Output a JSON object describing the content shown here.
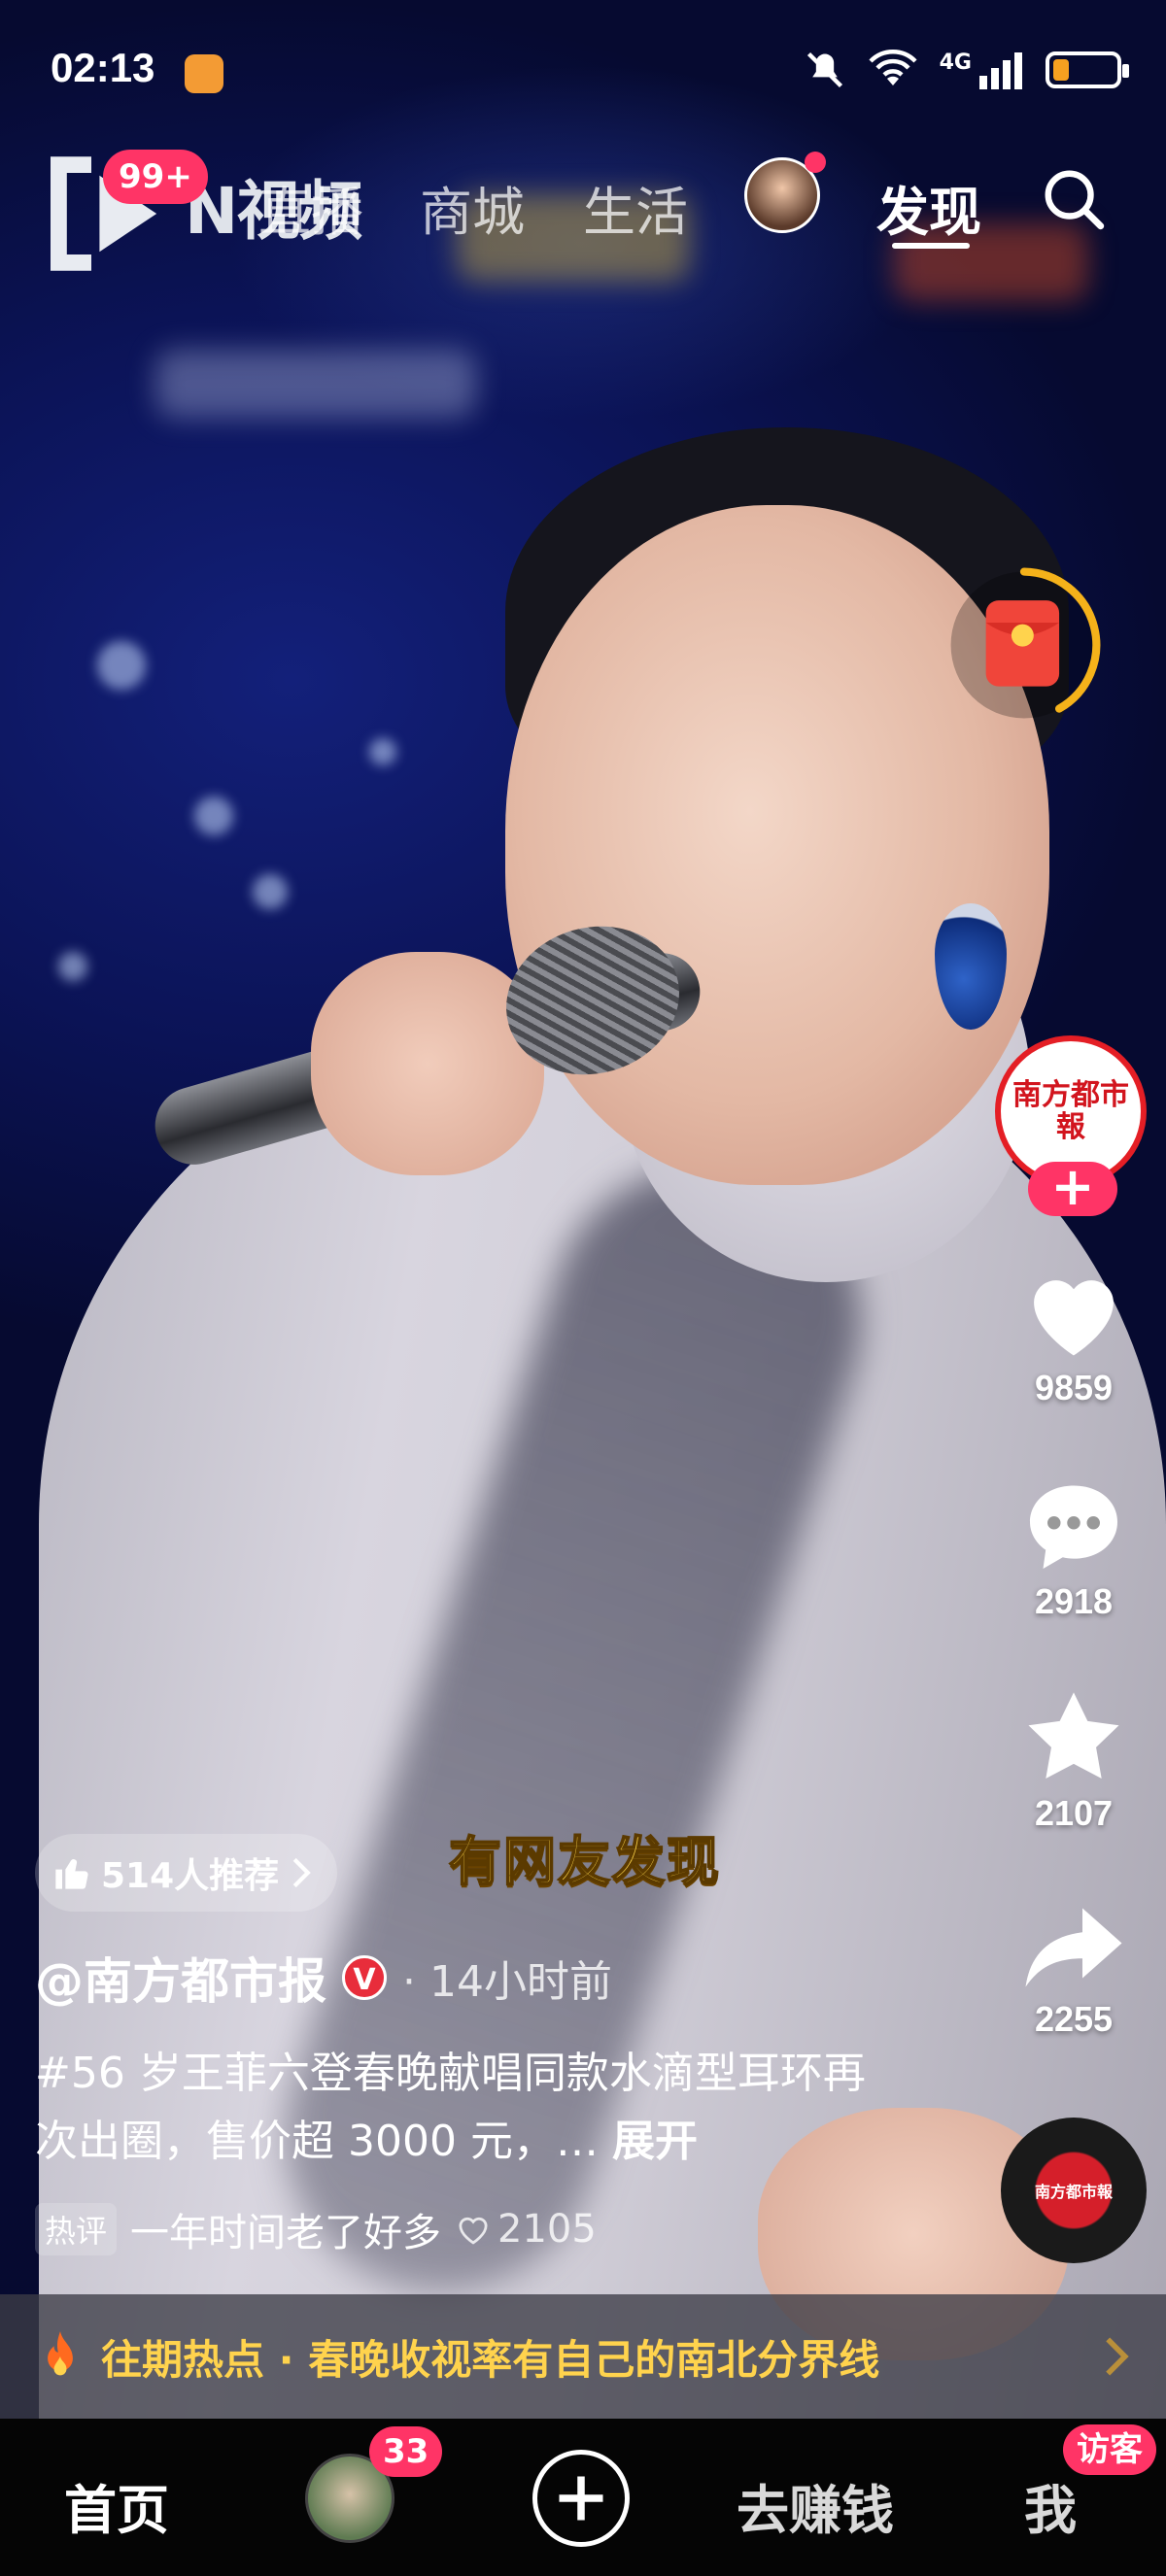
{
  "status_bar": {
    "time": "02:13",
    "network": "4G",
    "battery_percent": 25
  },
  "top_nav": {
    "logo_text": "N视频",
    "notification_badge": "99+",
    "tabs": [
      {
        "label": "直播"
      },
      {
        "label": "商城"
      },
      {
        "label": "生活"
      },
      {
        "label": "发现",
        "active": true
      }
    ]
  },
  "video": {
    "caption": "有网友发现"
  },
  "author": {
    "avatar_text": "南方都市報",
    "follow_label": "+",
    "handle": "@南方都市报",
    "verified": "V",
    "time_ago": "· 14小时前"
  },
  "actions": {
    "likes": "9859",
    "comments": "2918",
    "favorites": "2107",
    "shares": "2255"
  },
  "post": {
    "recommend": "514人推荐",
    "description": "#56 岁王菲六登春晚献唱同款水滴型耳环再次出圈，售价超 3000 元，…",
    "expand_label": "展开",
    "hot_tag": "热评",
    "hot_comment": "一年时间老了好多",
    "hot_comment_likes": "2105"
  },
  "hot_topic": {
    "text": "往期热点 · 春晚收视率有自己的南北分界线"
  },
  "bottom_nav": {
    "home": "首页",
    "friends_badge": "33",
    "earn": "去赚钱",
    "me": "我",
    "visitor_badge": "访客"
  },
  "colors": {
    "accent": "#ff3466",
    "hot_topic": "#ffd34d",
    "caption": "#ffd64a"
  }
}
